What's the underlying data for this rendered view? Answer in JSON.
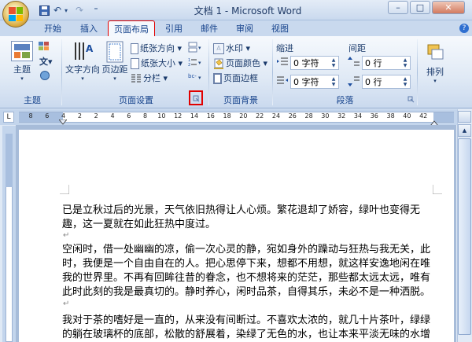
{
  "window": {
    "title": "文档 1 - Microsoft Word",
    "controls": {
      "minimize": "–",
      "maximize": "□",
      "close": "✕"
    }
  },
  "quick_access": {
    "save_icon": "save-icon",
    "undo": "↶",
    "redo": "↷",
    "customize": "⁼"
  },
  "tabs": [
    {
      "label": "开始"
    },
    {
      "label": "插入"
    },
    {
      "label": "页面布局",
      "active": true,
      "highlighted": true
    },
    {
      "label": "引用"
    },
    {
      "label": "邮件"
    },
    {
      "label": "审阅"
    },
    {
      "label": "视图"
    }
  ],
  "ribbon": {
    "themes": {
      "label": "主题",
      "group": "主题"
    },
    "page_setup": {
      "group": "页面设置",
      "text_direction": "文字方向",
      "margins": "页边距",
      "orientation": "纸张方向",
      "size": "纸张大小",
      "columns": "分栏"
    },
    "page_background": {
      "group": "页面背景",
      "watermark": "水印",
      "page_color": "页面颜色",
      "page_borders": "页面边框"
    },
    "paragraph": {
      "group": "段落",
      "indent_label": "缩进",
      "spacing_label": "间距",
      "indent_left": "0 字符",
      "indent_right": "0 字符",
      "spacing_before": "0 行",
      "spacing_after": "0 行"
    },
    "arrange": {
      "label": "排列"
    }
  },
  "ruler": {
    "numbers": [
      "8",
      "6",
      "4",
      "2",
      "2",
      "4",
      "6",
      "8",
      "10",
      "12",
      "14",
      "16",
      "18",
      "20",
      "22",
      "24",
      "26",
      "28",
      "30",
      "32",
      "34",
      "36",
      "38",
      "40",
      "42"
    ]
  },
  "document": {
    "paragraphs": [
      "已是立秋过后的光景，天气依旧热得让人心烦。繁花退却了娇容，绿叶也变得无趣，这一夏就在如此狂热中度过。",
      "空闲时，借一处幽幽的凉，偷一次心灵的静，宛如身外的躁动与狂热与我无关，此时，我便是一个自由自在的人。把心思停下来，想都不用想，就这样安逸地闲在唯我的世界里。不再有回眸往昔的眷念，也不想将来的茫茫，那些都太远太远，唯有此时此刻的我是最真切的。静时养心，闲时品茶，自得其乐，未必不是一种洒脱。",
      "我对于茶的嗜好是一直的，从来没有间断过。不喜欢太浓的，就几十片茶叶，绿绿的躺在玻璃杯的底部，松散的舒展着，染绿了无色的水，也让本来平淡无味的水增添了一丝丝的淡淡"
    ],
    "paragraph_mark": "↵"
  },
  "colors": {
    "highlight_red": "#e10000",
    "ribbon_text": "#15428b"
  }
}
